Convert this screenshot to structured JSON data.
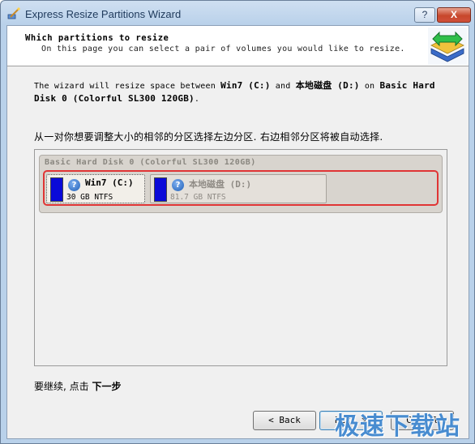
{
  "window": {
    "title": "Express Resize Partitions Wizard",
    "help_label": "?",
    "close_label": "X"
  },
  "header": {
    "title": "Which partitions to resize",
    "subtitle": "On this page you can select a pair of volumes you would like to resize."
  },
  "description": {
    "prefix": "The wizard will resize space between ",
    "vol1": "Win7 (C:)",
    "mid": " and ",
    "vol2": "本地磁盘 (D:)",
    "on": " on ",
    "disk": "Basic Hard Disk 0 (Colorful SL300 120GB)",
    "suffix": "."
  },
  "instruction": "从一对你想要调整大小的相邻的分区选择左边分区. 右边相邻分区将被自动选择.",
  "disk": {
    "title": "Basic Hard Disk 0 (Colorful SL300 120GB)",
    "partitions": [
      {
        "name": "Win7 (C:)",
        "info": "30 GB NTFS",
        "icon": "question-icon"
      },
      {
        "name": "本地磁盘 (D:)",
        "info": "81.7 GB NTFS",
        "icon": "question-icon"
      }
    ]
  },
  "footer": {
    "continue_prefix": "要继续, 点击 ",
    "continue_action": "下一步"
  },
  "buttons": {
    "back": "< Back",
    "next": "Next >",
    "cancel": "Cancel"
  },
  "watermark": "极速下载站",
  "colors": {
    "selection_frame": "#e03535",
    "partition_swatch": "#0a0ad8"
  }
}
